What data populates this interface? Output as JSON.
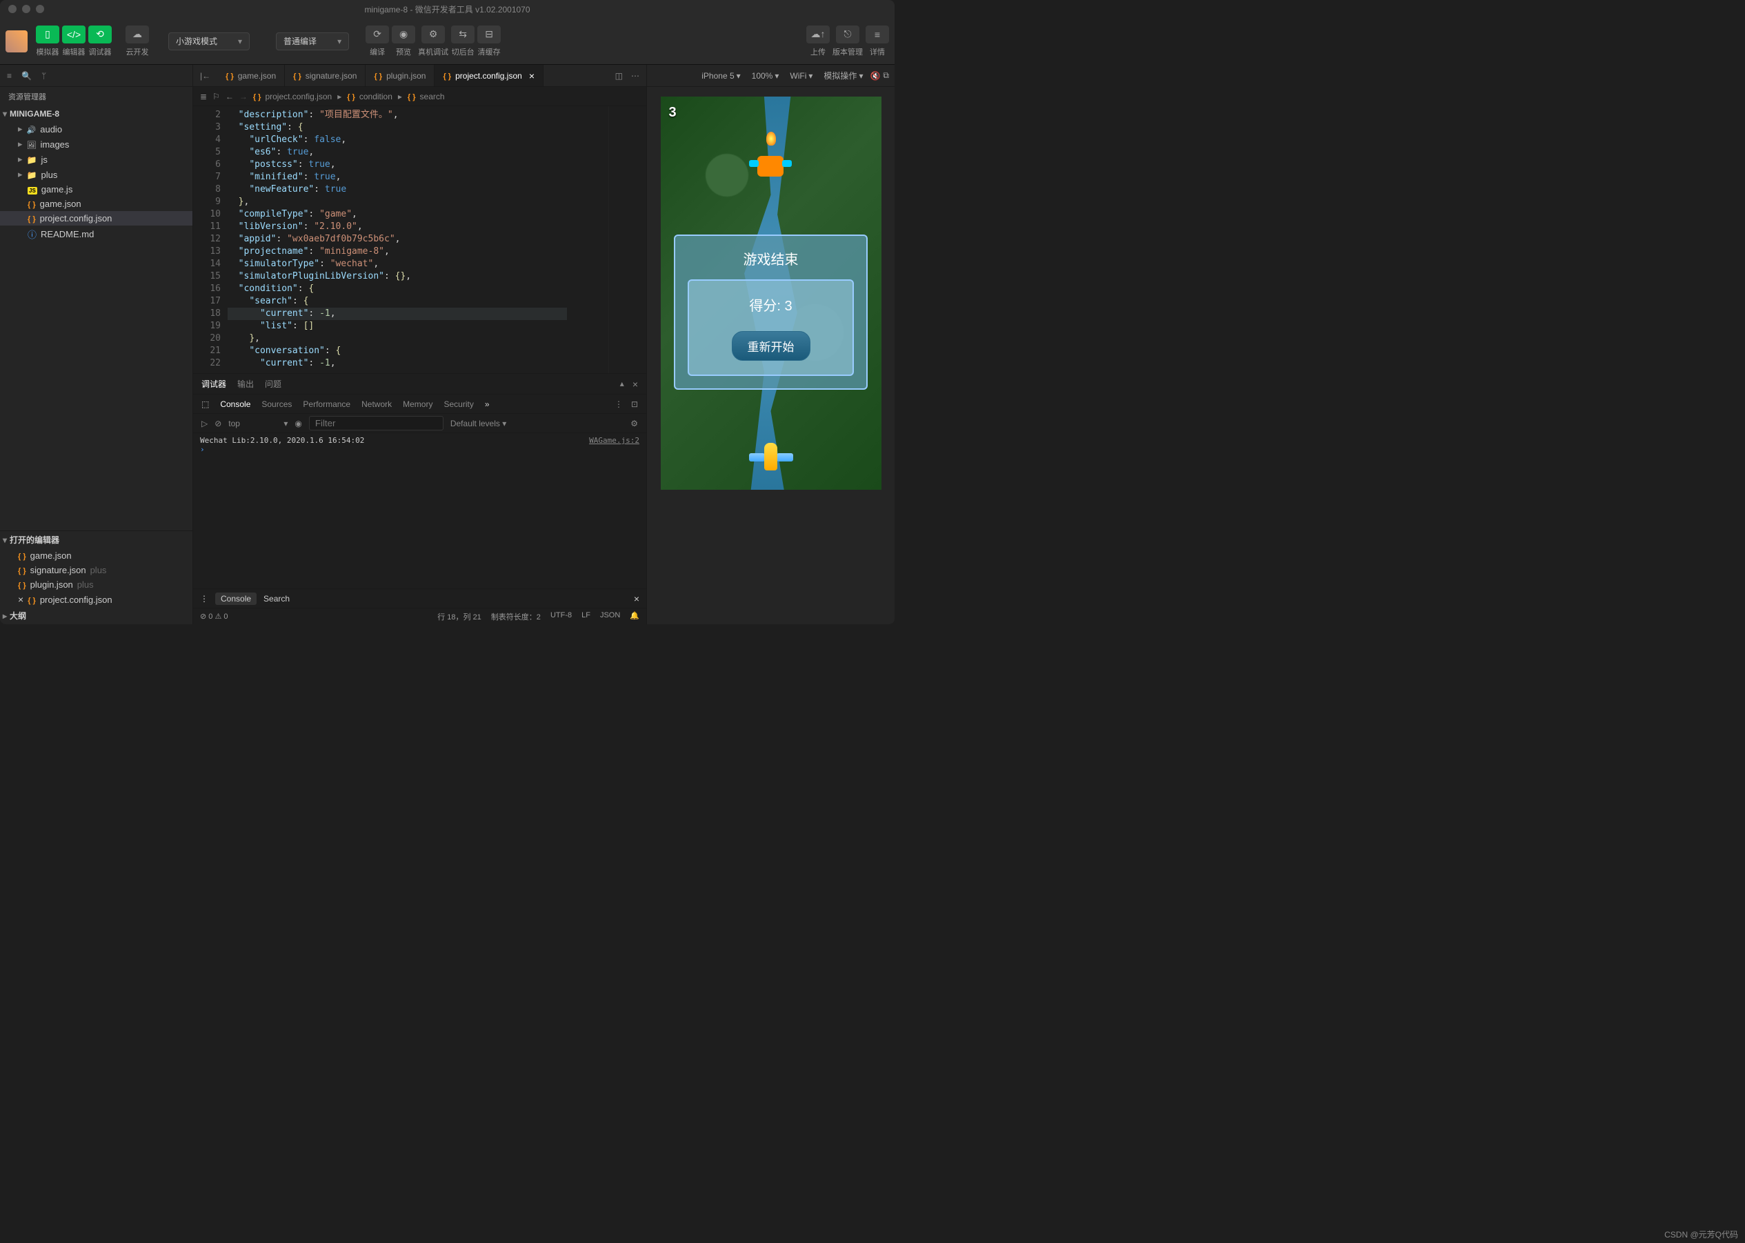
{
  "window": {
    "title": "minigame-8 - 微信开发者工具 v1.02.2001070"
  },
  "toolbar": {
    "simulator": "模拟器",
    "editor": "编辑器",
    "debugger": "调试器",
    "cloud": "云开发",
    "mode": "小游戏模式",
    "compile_mode": "普通编译",
    "compile": "编译",
    "preview": "预览",
    "remote": "真机调试",
    "background": "切后台",
    "clear": "清缓存",
    "upload": "上传",
    "version": "版本管理",
    "detail": "详情"
  },
  "sidebar": {
    "title": "资源管理器",
    "root": "MINIGAME-8",
    "items": [
      {
        "icon": "audio",
        "label": "audio"
      },
      {
        "icon": "img",
        "label": "images"
      },
      {
        "icon": "folder",
        "label": "js"
      },
      {
        "icon": "folder",
        "label": "plus"
      }
    ],
    "files": [
      {
        "icon": "js",
        "label": "game.js"
      },
      {
        "icon": "json",
        "label": "game.json"
      },
      {
        "icon": "json",
        "label": "project.config.json",
        "sel": true
      },
      {
        "icon": "info",
        "label": "README.md"
      }
    ],
    "open_section": "打开的编辑器",
    "open_items": [
      {
        "icon": "json",
        "label": "game.json"
      },
      {
        "icon": "json",
        "label": "signature.json",
        "suffix": "plus"
      },
      {
        "icon": "json",
        "label": "plugin.json",
        "suffix": "plus"
      },
      {
        "icon": "json",
        "label": "project.config.json",
        "prefix": "×"
      }
    ],
    "outline": "大纲"
  },
  "tabs": {
    "items": [
      {
        "icon": "json",
        "label": "game.json"
      },
      {
        "icon": "json",
        "label": "signature.json"
      },
      {
        "icon": "json",
        "label": "plugin.json"
      },
      {
        "icon": "json",
        "label": "project.config.json",
        "close": true,
        "active": true
      }
    ]
  },
  "breadcrumb": {
    "file": "project.config.json",
    "path1": "condition",
    "path2": "search"
  },
  "code": {
    "line_start": 2,
    "html": "  <span class='tok-key'>\"description\"</span><span class='tok-punc'>:</span> <span class='tok-str'>\"项目配置文件。\"</span><span class='tok-punc'>,</span>\n  <span class='tok-key'>\"setting\"</span><span class='tok-punc'>:</span> <span class='tok-y'>{</span>\n    <span class='tok-key'>\"urlCheck\"</span><span class='tok-punc'>:</span> <span class='tok-bool'>false</span><span class='tok-punc'>,</span>\n    <span class='tok-key'>\"es6\"</span><span class='tok-punc'>:</span> <span class='tok-bool'>true</span><span class='tok-punc'>,</span>\n    <span class='tok-key'>\"postcss\"</span><span class='tok-punc'>:</span> <span class='tok-bool'>true</span><span class='tok-punc'>,</span>\n    <span class='tok-key'>\"minified\"</span><span class='tok-punc'>:</span> <span class='tok-bool'>true</span><span class='tok-punc'>,</span>\n    <span class='tok-key'>\"newFeature\"</span><span class='tok-punc'>:</span> <span class='tok-bool'>true</span>\n  <span class='tok-y'>}</span><span class='tok-punc'>,</span>\n  <span class='tok-key'>\"compileType\"</span><span class='tok-punc'>:</span> <span class='tok-str'>\"game\"</span><span class='tok-punc'>,</span>\n  <span class='tok-key'>\"libVersion\"</span><span class='tok-punc'>:</span> <span class='tok-str'>\"2.10.0\"</span><span class='tok-punc'>,</span>\n  <span class='tok-key'>\"appid\"</span><span class='tok-punc'>:</span> <span class='tok-str'>\"wx0aeb7df0b79c5b6c\"</span><span class='tok-punc'>,</span>\n  <span class='tok-key'>\"projectname\"</span><span class='tok-punc'>:</span> <span class='tok-str'>\"minigame-8\"</span><span class='tok-punc'>,</span>\n  <span class='tok-key'>\"simulatorType\"</span><span class='tok-punc'>:</span> <span class='tok-str'>\"wechat\"</span><span class='tok-punc'>,</span>\n  <span class='tok-key'>\"simulatorPluginLibVersion\"</span><span class='tok-punc'>:</span> <span class='tok-y'>{}</span><span class='tok-punc'>,</span>\n  <span class='tok-key'>\"condition\"</span><span class='tok-punc'>:</span> <span class='tok-y'>{</span>\n    <span class='tok-key'>\"search\"</span><span class='tok-punc'>:</span> <span class='tok-y'>{</span>\n      <span class='tok-key'>\"current\"</span><span class='tok-punc'>:</span> <span class='tok-num'>-1</span><span class='tok-punc'>,</span>\n      <span class='tok-key'>\"list\"</span><span class='tok-punc'>:</span> <span class='tok-y'>[]</span>\n    <span class='tok-y'>}</span><span class='tok-punc'>,</span>\n    <span class='tok-key'>\"conversation\"</span><span class='tok-punc'>:</span> <span class='tok-y'>{</span>\n      <span class='tok-key'>\"current\"</span><span class='tok-punc'>:</span> <span class='tok-num'>-1</span><span class='tok-punc'>,</span>"
  },
  "debug": {
    "tabs": [
      "调试器",
      "输出",
      "问题"
    ],
    "devtabs": [
      "Console",
      "Sources",
      "Performance",
      "Network",
      "Memory",
      "Security"
    ],
    "top": "top",
    "filter_ph": "Filter",
    "levels": "Default levels ▾",
    "log": "Wechat Lib:2.10.0, 2020.1.6 16:54:02",
    "src": "WAGame.js:2",
    "footer_btn": "Console",
    "footer_search": "Search"
  },
  "status": {
    "errors": "⊘ 0  ⚠ 0",
    "pos": "行 18，列 21",
    "tab": "制表符长度：2",
    "enc": "UTF-8",
    "eol": "LF",
    "lang": "JSON"
  },
  "sim": {
    "device": "iPhone 5",
    "zoom": "100%",
    "net": "WiFi",
    "action": "模拟操作",
    "score": "3",
    "dlg_title": "游戏结束",
    "dlg_score": "得分: 3",
    "dlg_btn": "重新开始"
  },
  "watermark": "CSDN @元芳Q代码"
}
